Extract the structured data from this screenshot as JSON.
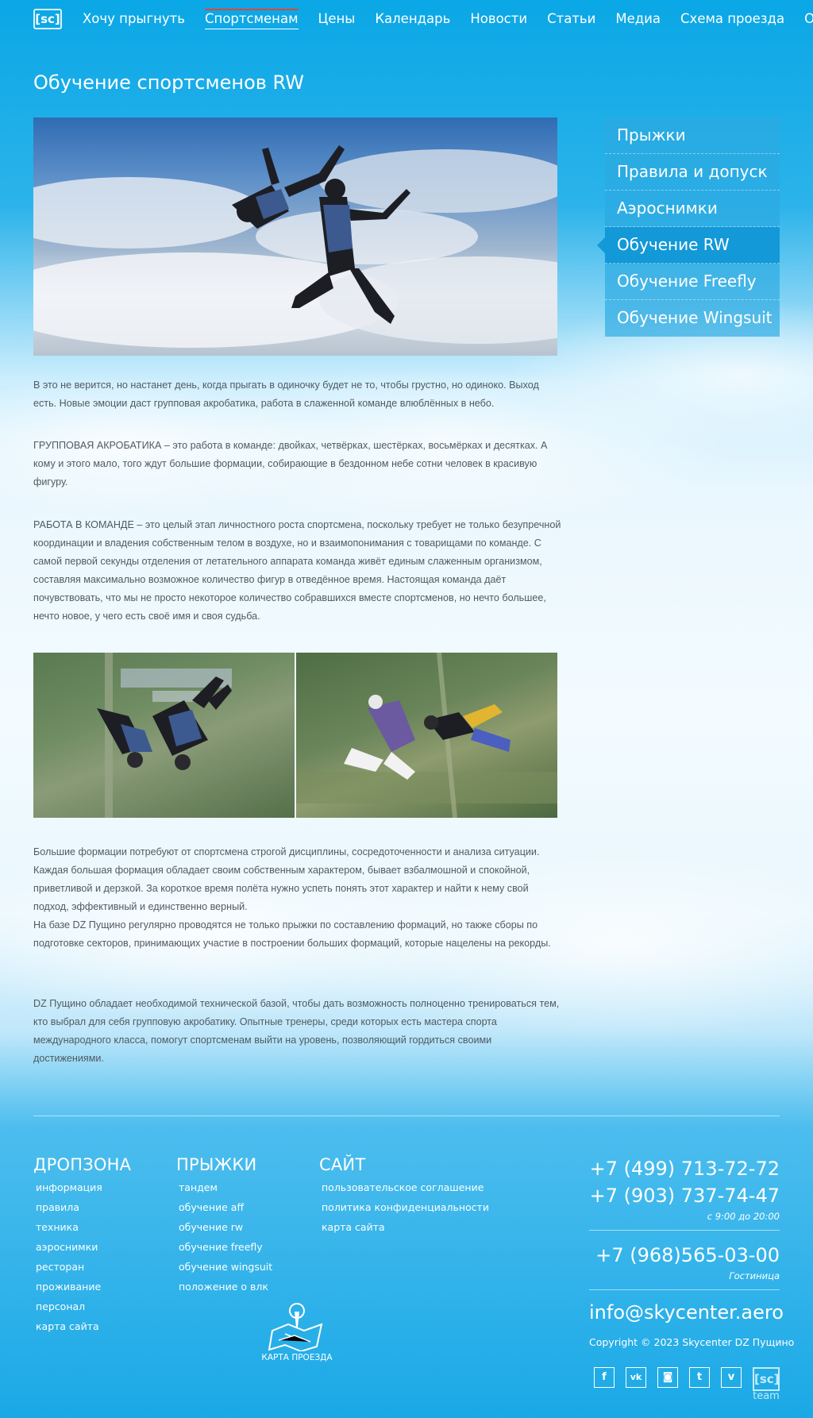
{
  "nav": {
    "logo": "[sc]",
    "items": [
      {
        "label": "Хочу прыгнуть"
      },
      {
        "label": "Спортсменам"
      },
      {
        "label": "Цены"
      },
      {
        "label": "Календарь"
      },
      {
        "label": "Новости"
      },
      {
        "label": "Статьи"
      },
      {
        "label": "Медиа"
      },
      {
        "label": "Схема проезда"
      },
      {
        "label": "О нас"
      }
    ],
    "active_index": 1
  },
  "page": {
    "title": "Обучение спортсменов RW",
    "paragraphs": [
      "В это не верится, но настанет день, когда прыгать в одиночку будет не то, чтобы грустно, но одиноко. Выход есть. Новые эмоции даст групповая акробатика, работа в слаженной команде влюблённых в небо.",
      "ГРУППОВАЯ АКРОБАТИКА – это работа в команде: двойках, четвёрках, шестёрках, восьмёрках и десятках. А кому и этого мало, того ждут большие формации, собирающие в бездонном небе сотни человек в красивую фигуру.",
      "РАБОТА В КОМАНДЕ – это целый этап личностного роста спортсмена, поскольку требует не только безупречной координации и владения собственным телом в воздухе, но и взаимопонимания с товарищами по команде. С самой первой секунды отделения от летательного аппарата команда живёт единым слаженным организмом, составляя максимально возможное количество фигур в отведённое время. Настоящая команда даёт почувствовать, что мы не просто некоторое количество собравшихся вместе спортсменов, но нечто большее, нечто новое, у чего есть своё имя и своя судьба.",
      "Большие формации потребуют от спортсмена строгой дисциплины, сосредоточенности и анализа ситуации. Каждая большая формация обладает своим собственным характером, бывает взбалмошной и спокойной, приветливой и дерзкой. За короткое время полёта нужно успеть понять этот характер и найти к нему свой подход, эффективный и единственно верный.",
      "На базе DZ Пущино регулярно проводятся не только прыжки по составлению формаций, но также сборы по подготовке секторов, принимающих участие в построении больших формаций, которые нацелены на рекорды.",
      "DZ Пущино обладает необходимой технической базой, чтобы дать возможность полноценно тренироваться тем, кто выбрал для себя групповую акробатику. Опытные тренеры, среди которых есть мастера спорта международного класса, помогут спортсменам выйти на уровень, позволяющий гордиться своими достижениями."
    ]
  },
  "sidebar": {
    "items": [
      {
        "label": "Прыжки"
      },
      {
        "label": "Правила и допуск"
      },
      {
        "label": "Аэроснимки"
      },
      {
        "label": "Обучение RW"
      },
      {
        "label": "Обучение Freefly"
      },
      {
        "label": "Обучение Wingsuit"
      }
    ],
    "active_index": 3
  },
  "footer": {
    "col1": {
      "title": "ДРОПЗОНА",
      "links": [
        "информация",
        "правила",
        "техника",
        "аэроснимки",
        "ресторан",
        "проживание",
        "персонал",
        "карта сайта"
      ]
    },
    "col2": {
      "title": "ПРЫЖКИ",
      "links": [
        "тандем",
        "обучение aff",
        "обучение rw",
        "обучение freefly",
        "обучение wingsuit",
        "положение о влк"
      ]
    },
    "col3": {
      "title": "САЙТ",
      "links": [
        "пользовательское соглашение",
        "политика конфиденциальности",
        "карта сайта"
      ]
    },
    "map_label": "КАРТА ПРОЕЗДА",
    "contacts": {
      "phone1": "+7 (499) 713-72-72",
      "phone2": "+7 (903) 737-74-47",
      "hours": "с 9:00 до 20:00",
      "phone3": "+7 (968)565-03-00",
      "phone3_note": "Гостиница",
      "email": "info@skycenter.aero",
      "copyright": "Copyright © 2023 Skycenter DZ Пущино"
    },
    "socials": [
      {
        "icon": "facebook-icon",
        "glyph": "f"
      },
      {
        "icon": "vk-icon",
        "glyph": "vk"
      },
      {
        "icon": "instagram-icon",
        "glyph": "◙"
      },
      {
        "icon": "twitter-icon",
        "glyph": "t"
      },
      {
        "icon": "vimeo-icon",
        "glyph": "v"
      }
    ],
    "team_logo": {
      "mark": "[sc]",
      "label": "team"
    }
  },
  "colors": {
    "accent_red": "#e0443b",
    "sidebar_active": "#1398d8",
    "sky_blue": "#0aa7e6",
    "body_text": "#505a62"
  }
}
